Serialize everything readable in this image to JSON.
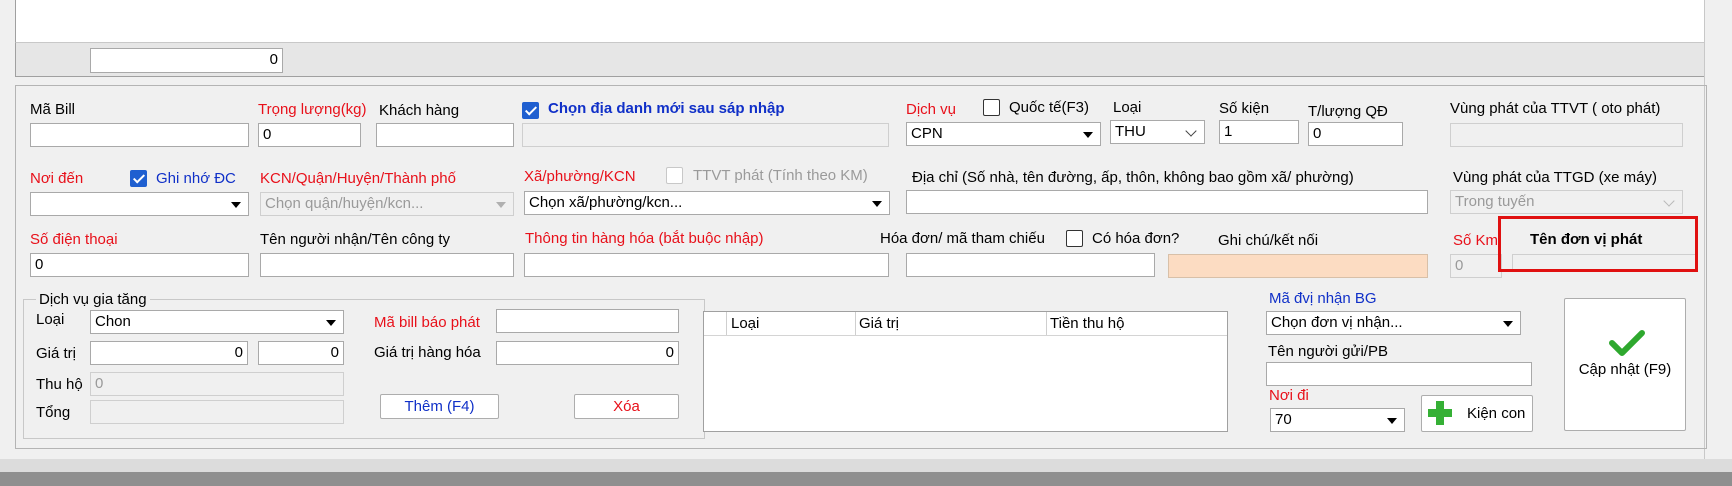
{
  "top_grid": {
    "counter_value": "0"
  },
  "bill": {
    "label": "Mã Bill",
    "value": ""
  },
  "weight": {
    "label": "Trọng lượng(kg)",
    "value": "0"
  },
  "customer": {
    "label": "Khách hàng",
    "value": ""
  },
  "new_place": {
    "label": "Chọn địa danh mới sau sáp nhập",
    "checked": true,
    "value": ""
  },
  "service": {
    "label": "Dịch vụ",
    "value": "CPN"
  },
  "international": {
    "label": "Quốc tế(F3)",
    "checked": false
  },
  "type": {
    "label": "Loại",
    "value": "THU"
  },
  "packages": {
    "label": "Số kiện",
    "value": "1"
  },
  "weight_qd": {
    "label": "T/lượng QĐ",
    "value": "0"
  },
  "ttvt_zone": {
    "label": "Vùng phát của TTVT ( oto phát)",
    "value": ""
  },
  "destination": {
    "label": "Nơi đến",
    "value": ""
  },
  "remember_dc": {
    "label": "Ghi nhớ ĐC",
    "checked": true
  },
  "district": {
    "label": "KCN/Quận/Huyện/Thành phố",
    "placeholder": "Chọn quận/huyện/kcn..."
  },
  "ward": {
    "label": "Xã/phường/KCN",
    "placeholder": "Chọn xã/phường/kcn..."
  },
  "ttvt_km": {
    "label": "TTVT phát (Tính theo KM)",
    "checked": false
  },
  "address": {
    "label": "Địa chỉ (Số nhà, tên đường, ấp, thôn, không bao gồm xã/ phường)",
    "value": ""
  },
  "ttgd_zone": {
    "label": "Vùng phát của TTGD (xe máy)",
    "value": "Trong tuyến"
  },
  "phone": {
    "label": "Số điện thoại",
    "value": "0"
  },
  "receiver": {
    "label": "Tên người nhận/Tên công ty",
    "value": ""
  },
  "goods_info": {
    "label": "Thông tin hàng hóa (bắt buộc nhập)",
    "value": ""
  },
  "invoice_ref": {
    "label": "Hóa đơn/ mã tham chiếu",
    "value": ""
  },
  "has_invoice": {
    "label": "Có hóa đơn?",
    "checked": false
  },
  "note": {
    "label": "Ghi chú/kết nối",
    "value": ""
  },
  "km": {
    "label": "Số Km",
    "value": "0"
  },
  "delivery_unit": {
    "label": "Tên đơn vị phát",
    "value": ""
  },
  "vas": {
    "title": "Dịch vụ gia tăng",
    "type_label": "Loại",
    "type_value": "Chon",
    "value_label": "Giá trị",
    "value1": "0",
    "value2": "0",
    "cod_label": "Thu hộ",
    "cod_value": "0",
    "total_label": "Tổng",
    "total_value": ""
  },
  "report_bill": {
    "label": "Mã bill báo phát",
    "value": ""
  },
  "goods_value": {
    "label": "Giá trị hàng hóa",
    "value": "0"
  },
  "add_button": "Thêm (F4)",
  "delete_button": "Xóa",
  "vas_table": {
    "columns": [
      "Loại",
      "Giá trị",
      "Tiền thu hộ"
    ]
  },
  "bg_unit": {
    "label": "Mã đvị nhận BG",
    "placeholder": "Chọn đơn vị nhận..."
  },
  "sender": {
    "label": "Tên người gửi/PB",
    "value": ""
  },
  "origin": {
    "label": "Nơi đi",
    "value": "70"
  },
  "sub_package_button": "Kiện con",
  "update_button": "Cập nhật (F9)",
  "colors": {
    "required_label": "#e8101a",
    "link_label": "#1030c8",
    "highlight_border": "#e01010",
    "check_green": "#2ea82e"
  }
}
